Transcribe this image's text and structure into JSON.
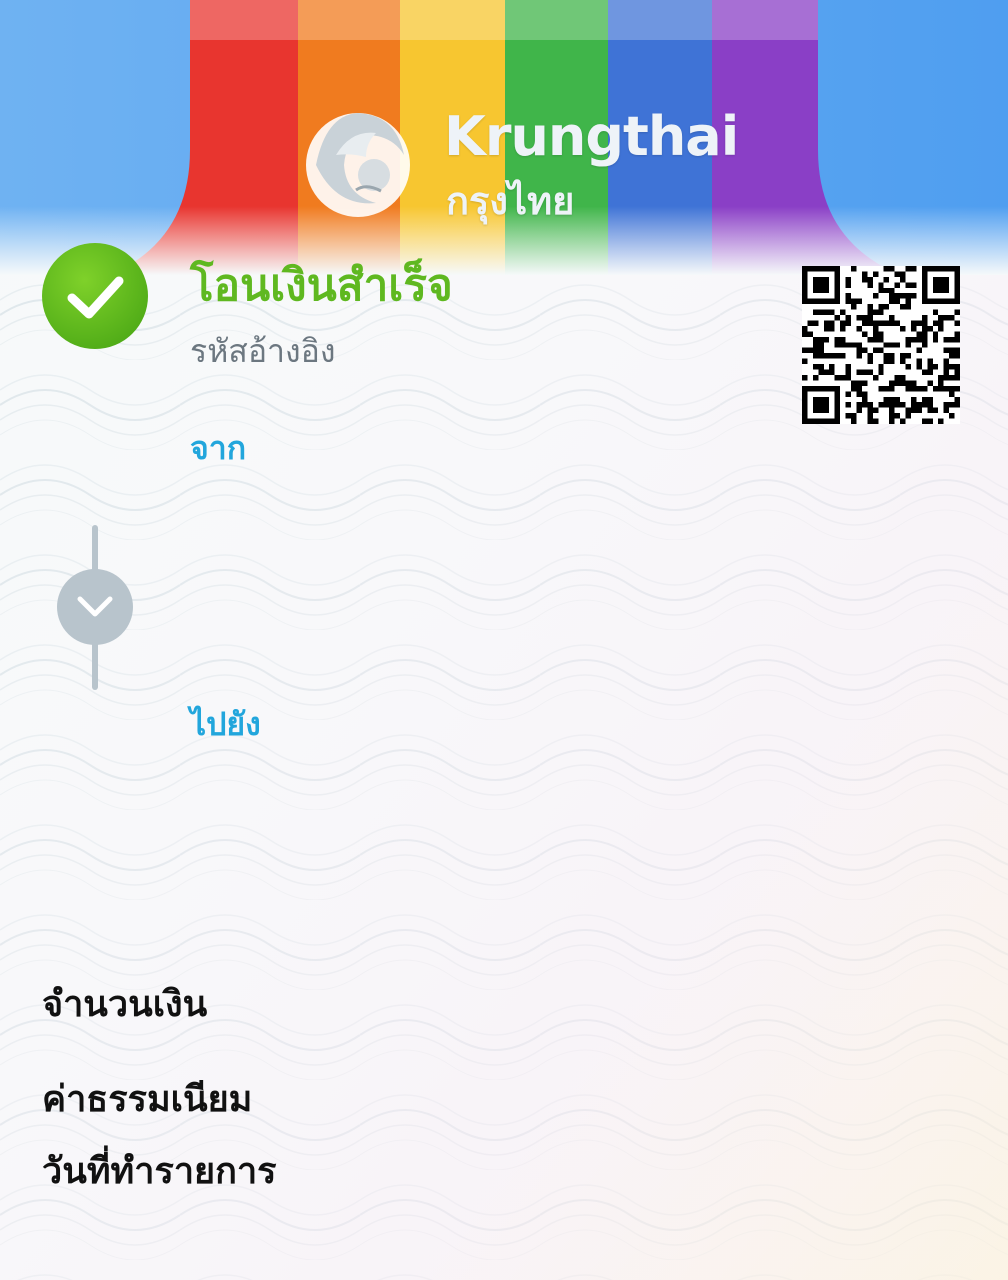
{
  "header": {
    "brand_name": "Krungthai",
    "brand_name_thai": "กรุงไทย",
    "ribbon_colors": [
      "#e8352f",
      "#f07b1f",
      "#f7c630",
      "#40b54a",
      "#3f73d6",
      "#8a3fc6"
    ],
    "sky_color": "#5aa6f0"
  },
  "status": {
    "title": "โอนเงินสำเร็จ",
    "reference_label": "รหัสอ้างอิง",
    "title_color": "#5fb820"
  },
  "transfer": {
    "from_label": "จาก",
    "to_label": "ไปยัง",
    "label_color": "#22a6dc"
  },
  "details": {
    "amount_label": "จำนวนเงิน",
    "fee_label": "ค่าธรรมเนียม",
    "date_label": "วันที่ทำรายการ"
  },
  "icons": {
    "check": "check-circle-icon",
    "chevron": "chevron-down-icon",
    "qr": "qr-code-icon",
    "logo": "krungthai-bird-logo"
  }
}
